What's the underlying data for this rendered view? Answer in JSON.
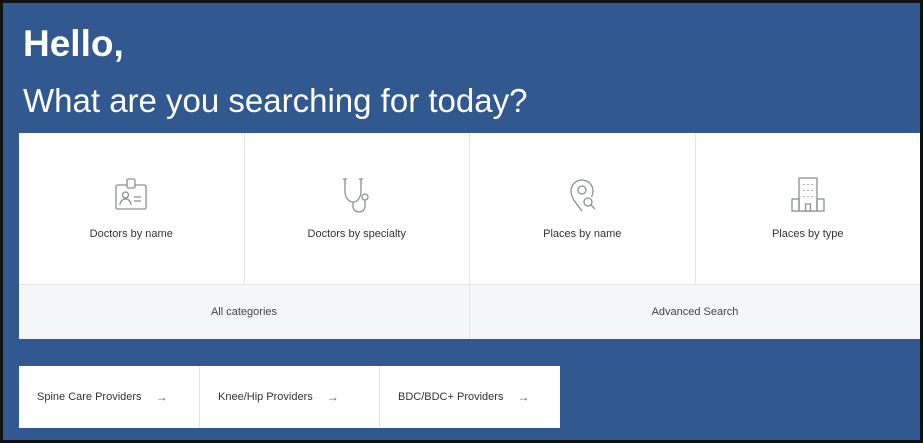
{
  "header": {
    "greeting": "Hello,",
    "subheading": "What are you searching for today?"
  },
  "search_cards": [
    {
      "label": "Doctors by name",
      "icon": "id-badge-icon"
    },
    {
      "label": "Doctors by specialty",
      "icon": "stethoscope-icon"
    },
    {
      "label": "Places by name",
      "icon": "location-search-icon"
    },
    {
      "label": "Places by type",
      "icon": "building-icon"
    }
  ],
  "links": {
    "all_categories": "All categories",
    "advanced_search": "Advanced Search"
  },
  "quick_links": [
    {
      "label": "Spine Care Providers",
      "arrow": "→"
    },
    {
      "label": "Knee/Hip Providers",
      "arrow": "→"
    },
    {
      "label": "BDC/BDC+ Providers",
      "arrow": "→"
    }
  ],
  "colors": {
    "background": "#31598f",
    "panel": "#ffffff",
    "secondary_row": "#f5f6f8",
    "icon_stroke": "#8a8f98"
  }
}
